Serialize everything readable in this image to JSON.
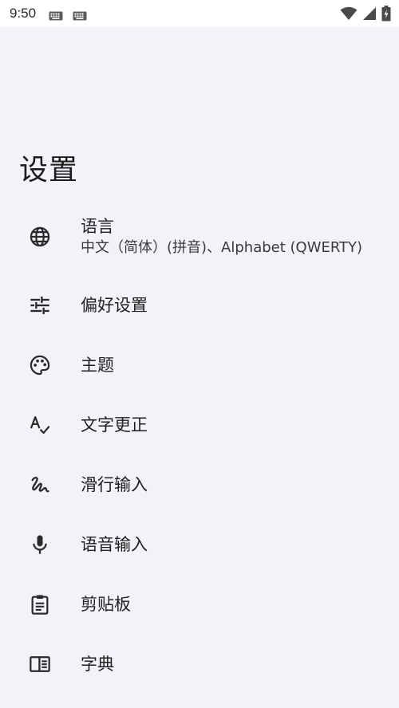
{
  "status_bar": {
    "time": "9:50",
    "left_icons": [
      "keyboard-icon",
      "keyboard-icon"
    ],
    "right_icons": [
      "wifi-icon",
      "signal-icon",
      "battery-charging-icon"
    ]
  },
  "page": {
    "title": "设置"
  },
  "settings": {
    "items": [
      {
        "icon": "globe-icon",
        "title": "语言",
        "subtitle": "中文（简体）(拼音)、Alphabet (QWERTY)"
      },
      {
        "icon": "tune-icon",
        "title": "偏好设置"
      },
      {
        "icon": "palette-icon",
        "title": "主题"
      },
      {
        "icon": "spellcheck-icon",
        "title": "文字更正"
      },
      {
        "icon": "gesture-icon",
        "title": "滑行输入"
      },
      {
        "icon": "mic-icon",
        "title": "语音输入"
      },
      {
        "icon": "clipboard-icon",
        "title": "剪贴板"
      },
      {
        "icon": "dictionary-icon",
        "title": "字典"
      }
    ]
  },
  "colors": {
    "background": "#f1f3f8",
    "status_bar": "#ffffff",
    "text": "#1f1f1f",
    "icon": "#2a2a2a"
  }
}
